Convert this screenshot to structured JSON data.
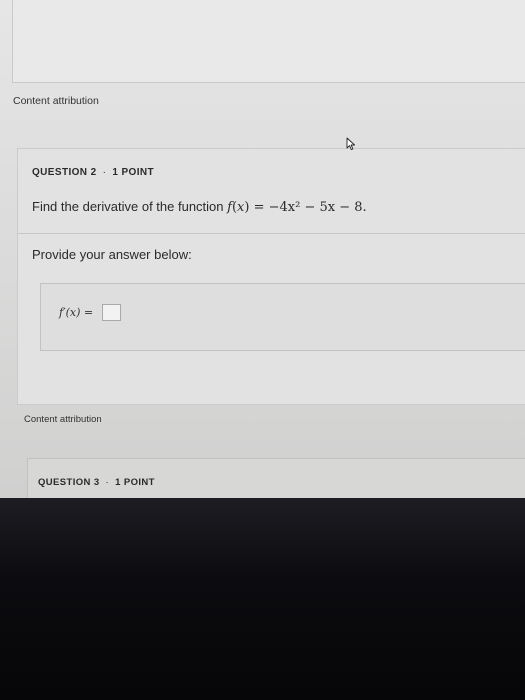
{
  "top_attribution": "Content attribution",
  "question2": {
    "number_label": "QUESTION 2",
    "separator": "·",
    "points_label": "1 POINT",
    "prompt_prefix": "Find the derivative of the function ",
    "function_name": "f",
    "function_var": "x",
    "expression": "= −4x² − 5x − 8.",
    "provide_label": "Provide your answer below:",
    "answer_label": "f′(x) =",
    "answer_value": ""
  },
  "bottom_attribution": "Content attribution",
  "question3": {
    "number_label": "QUESTION 3",
    "separator": "·",
    "points_label": "1 POINT"
  },
  "icons": {
    "cursor": "mouse-pointer-icon"
  }
}
